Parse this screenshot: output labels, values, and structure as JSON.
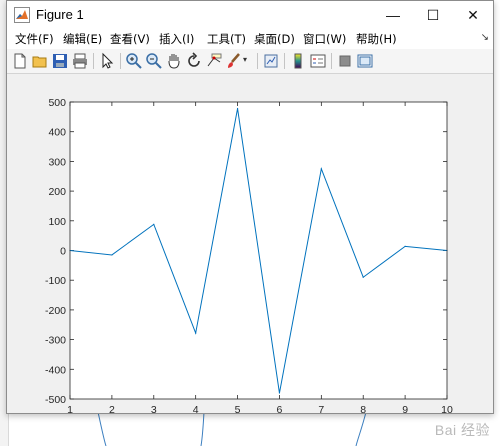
{
  "window": {
    "title": "Figure 1",
    "controls": {
      "minimize": "—",
      "maximize": "☐",
      "close": "✕"
    }
  },
  "menu": {
    "items": [
      "文件(F)",
      "编辑(E)",
      "查看(V)",
      "插入(I)",
      "工具(T)",
      "桌面(D)",
      "窗口(W)",
      "帮助(H)"
    ],
    "overflow_arrow": "↘"
  },
  "toolbar": {
    "icons": [
      "new-figure-icon",
      "open-file-icon",
      "save-icon",
      "print-icon",
      "edit-plot-arrow-icon",
      "zoom-in-icon",
      "zoom-out-icon",
      "pan-hand-icon",
      "rotate-3d-icon",
      "data-cursor-icon",
      "brush-icon",
      "brush-dropdown-icon",
      "link-plot-icon",
      "insert-colorbar-icon",
      "insert-legend-icon",
      "hide-plot-tools-icon",
      "show-plot-tools-icon"
    ]
  },
  "chart_data": {
    "type": "line",
    "x": [
      1,
      2,
      3,
      4,
      5,
      6,
      7,
      8,
      9,
      10
    ],
    "series": [
      {
        "values": [
          0,
          -15,
          88,
          -278,
          478,
          -480,
          275,
          -90,
          14,
          0
        ],
        "color": "#0072BD"
      }
    ],
    "xlim": [
      1,
      10
    ],
    "ylim": [
      -500,
      500
    ],
    "xticks": [
      "1",
      "2",
      "3",
      "4",
      "5",
      "6",
      "7",
      "8",
      "9",
      "10"
    ],
    "yticks": [
      "500",
      "400",
      "300",
      "200",
      "100",
      "0",
      "-100",
      "-200",
      "-300",
      "-400",
      "-500"
    ],
    "title": "",
    "xlabel": "",
    "ylabel": "",
    "grid": false
  },
  "watermark": "Bai 经验"
}
